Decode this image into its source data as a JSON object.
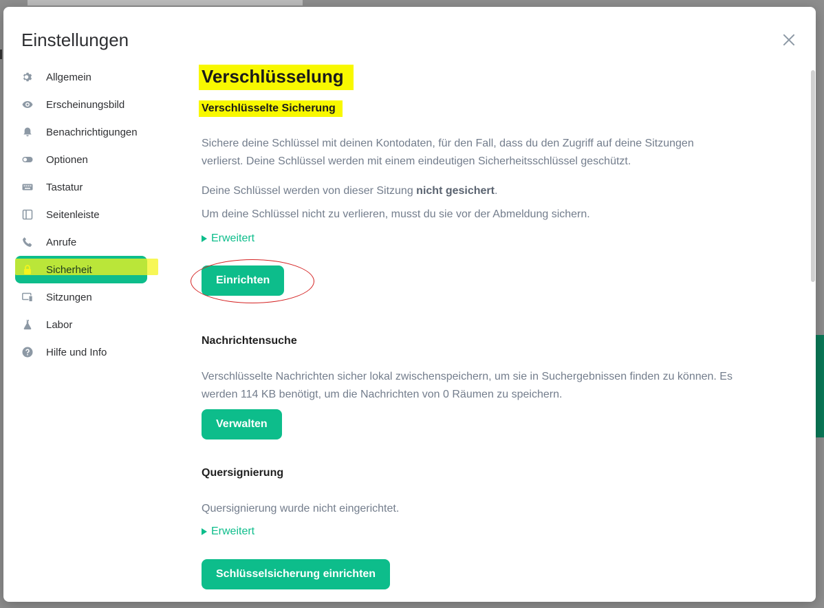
{
  "dialog": {
    "title": "Einstellungen"
  },
  "sidebar": {
    "items": [
      {
        "label": "Allgemein",
        "icon": "gear-icon"
      },
      {
        "label": "Erscheinungsbild",
        "icon": "eye-icon"
      },
      {
        "label": "Benachrichtigungen",
        "icon": "bell-icon"
      },
      {
        "label": "Optionen",
        "icon": "toggle-icon"
      },
      {
        "label": "Tastatur",
        "icon": "keyboard-icon"
      },
      {
        "label": "Seitenleiste",
        "icon": "sidebar-icon"
      },
      {
        "label": "Anrufe",
        "icon": "phone-icon"
      },
      {
        "label": "Sicherheit",
        "icon": "lock-icon",
        "active": true
      },
      {
        "label": "Sitzungen",
        "icon": "devices-icon"
      },
      {
        "label": "Labor",
        "icon": "flask-icon"
      },
      {
        "label": "Hilfe und Info",
        "icon": "help-icon"
      }
    ]
  },
  "content": {
    "title": "Verschlüsselung",
    "backup": {
      "title": "Verschlüsselte Sicherung",
      "desc": "Sichere deine Schlüssel mit deinen Kontodaten, für den Fall, dass du den Zugriff auf deine Sitzungen verlierst. Deine Schlüssel werden mit einem eindeutigen Sicherheitsschlüssel geschützt.",
      "status_prefix": "Deine Schlüssel werden von dieser Sitzung ",
      "status_bold": "nicht gesichert",
      "status_suffix": ".",
      "hint": "Um deine Schlüssel nicht zu verlieren, musst du sie vor der Abmeldung sichern.",
      "advanced": "Erweitert",
      "button": "Einrichten"
    },
    "search": {
      "title": "Nachrichtensuche",
      "desc": "Verschlüsselte Nachrichten sicher lokal zwischenspeichern, um sie in Suchergebnissen finden zu können. Es werden 114 KB benötigt, um die Nachrichten von 0 Räumen zu speichern.",
      "button": "Verwalten"
    },
    "cross_signing": {
      "title": "Quersignierung",
      "desc": "Quersignierung wurde nicht eingerichtet.",
      "advanced": "Erweitert",
      "button": "Schlüsselsicherung einrichten"
    }
  },
  "colors": {
    "accent": "#0dbd8b",
    "highlight": "#f8f800",
    "annotation": "#d42020"
  }
}
